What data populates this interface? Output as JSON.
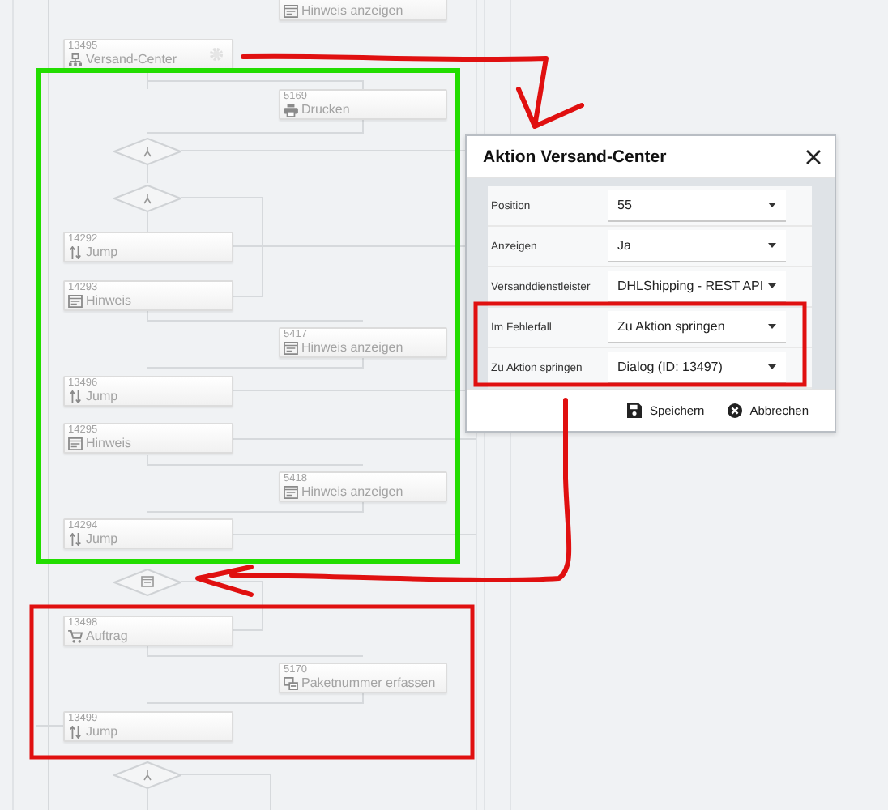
{
  "flow": {
    "nodes": [
      {
        "label": "Hinweis anzeigen",
        "kind": "message",
        "settings": false
      },
      {
        "id": "13495",
        "label": "Versand-Center",
        "kind": "network",
        "settings": true
      },
      {
        "id": "5169",
        "label": "Drucken",
        "kind": "printer",
        "settings": false
      },
      {
        "id": "14292",
        "label": "Jump",
        "kind": "jump",
        "settings": false
      },
      {
        "id": "14293",
        "label": "Hinweis",
        "kind": "message",
        "settings": false
      },
      {
        "id": "5417",
        "label": "Hinweis anzeigen",
        "kind": "message",
        "settings": false
      },
      {
        "id": "13496",
        "label": "Jump",
        "kind": "jump",
        "settings": false
      },
      {
        "id": "14295",
        "label": "Hinweis",
        "kind": "message",
        "settings": false
      },
      {
        "id": "5418",
        "label": "Hinweis anzeigen",
        "kind": "message",
        "settings": false
      },
      {
        "id": "14294",
        "label": "Jump",
        "kind": "jump",
        "settings": false
      },
      {
        "id": "13498",
        "label": "Auftrag",
        "kind": "cart",
        "settings": false
      },
      {
        "id": "5170",
        "label": "Paketnummer erfassen",
        "kind": "package",
        "settings": false
      },
      {
        "id": "13499",
        "label": "Jump",
        "kind": "jump",
        "settings": false
      }
    ],
    "decisions": [
      {
        "kind": "fork"
      },
      {
        "kind": "fork"
      },
      {
        "kind": "message"
      },
      {
        "kind": "fork"
      }
    ]
  },
  "dialog": {
    "title": "Aktion Versand-Center",
    "fields": [
      {
        "label": "Position",
        "value": "55"
      },
      {
        "label": "Anzeigen",
        "value": "Ja"
      },
      {
        "label": "Versanddienstleister",
        "value": "DHLShipping - REST API"
      },
      {
        "label": "Im Fehlerfall",
        "value": "Zu Aktion springen"
      },
      {
        "label": "Zu Aktion springen",
        "value": "Dialog (ID: 13497)"
      }
    ],
    "buttons": [
      {
        "label": "Speichern",
        "kind": "save"
      },
      {
        "label": "Abbrechen",
        "kind": "cancel"
      }
    ]
  }
}
